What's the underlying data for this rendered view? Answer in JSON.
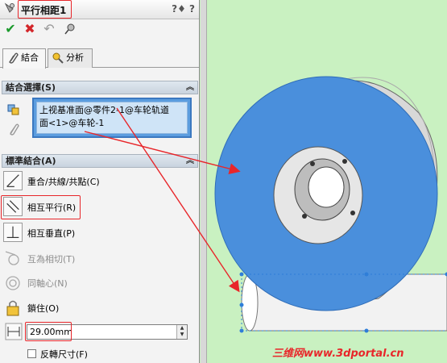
{
  "title": "平行相距1",
  "help_glyphs": "?♦ ?",
  "tabs": [
    {
      "label": "結合",
      "active": true
    },
    {
      "label": "分析",
      "active": false
    }
  ],
  "selection_group": {
    "header": "結合選擇(S)",
    "line1": "上视基准面@零件2-1@车轮轨道",
    "line2": "面<1>@车轮-1"
  },
  "standard_group": {
    "header": "標準結合(A)",
    "items": [
      {
        "label": "重合/共線/共點(C)",
        "enabled": true
      },
      {
        "label": "相互平行(R)",
        "enabled": true,
        "highlighted": true
      },
      {
        "label": "相互垂直(P)",
        "enabled": true
      },
      {
        "label": "互為相切(T)",
        "enabled": false
      },
      {
        "label": "同軸心(N)",
        "enabled": false
      },
      {
        "label": "鎖住(O)",
        "enabled": true
      }
    ]
  },
  "distance": {
    "value": "29.00mm"
  },
  "flip": {
    "label": "反轉尺寸(F)",
    "checked": false
  },
  "watermark": "三维网www.3dportal.cn",
  "colors": {
    "accent_red": "#e8262a",
    "face_blue": "#4a8fdc",
    "background_green": "#c9f1c1"
  }
}
